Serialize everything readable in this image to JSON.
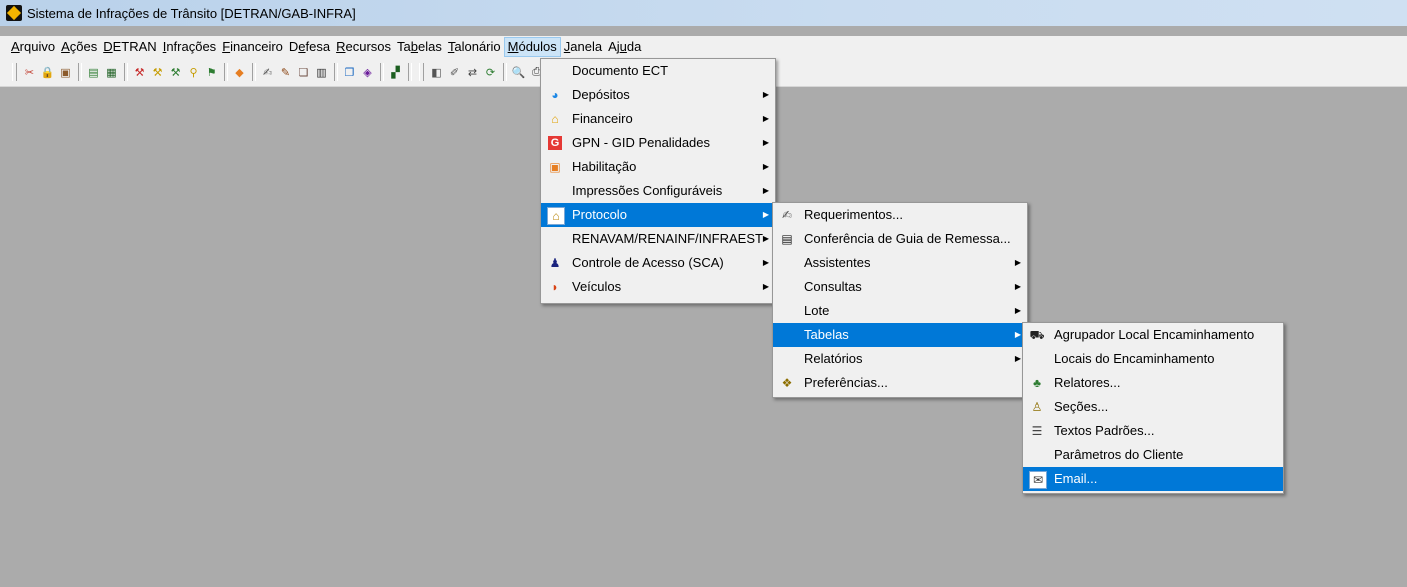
{
  "window": {
    "title": "Sistema de Infrações de Trânsito [DETRAN/GAB-INFRA]"
  },
  "menubar": [
    {
      "label": "Arquivo"
    },
    {
      "label": "Ações"
    },
    {
      "label": "DETRAN"
    },
    {
      "label": "Infrações"
    },
    {
      "label": "Financeiro"
    },
    {
      "label": "Defesa"
    },
    {
      "label": "Recursos"
    },
    {
      "label": "Tabelas"
    },
    {
      "label": "Talonário"
    },
    {
      "label": "Módulos"
    },
    {
      "label": "Janela"
    },
    {
      "label": "Ajuda"
    }
  ],
  "modulos_menu": [
    {
      "label": "Documento ECT",
      "icon": "",
      "submenu": false
    },
    {
      "label": "Depósitos",
      "icon": "deposit-icon",
      "submenu": true
    },
    {
      "label": "Financeiro",
      "icon": "finance-icon",
      "submenu": true
    },
    {
      "label": "GPN - GID Penalidades",
      "icon": "gpn-icon",
      "submenu": true
    },
    {
      "label": "Habilitação",
      "icon": "license-icon",
      "submenu": true
    },
    {
      "label": "Impressões Configuráveis",
      "icon": "",
      "submenu": true
    },
    {
      "label": "Protocolo",
      "icon": "protocol-icon",
      "submenu": true,
      "selected": true
    },
    {
      "label": "RENAVAM/RENAINF/INFRAEST",
      "icon": "",
      "submenu": true
    },
    {
      "label": "Controle de Acesso (SCA)",
      "icon": "access-icon",
      "submenu": true
    },
    {
      "label": "Veículos",
      "icon": "vehicle-icon",
      "submenu": true
    }
  ],
  "protocolo_menu": [
    {
      "label": "Requerimentos...",
      "icon": "request-icon",
      "submenu": false
    },
    {
      "label": "Conferência de Guia de Remessa...",
      "icon": "guide-icon",
      "submenu": false
    },
    {
      "label": "Assistentes",
      "icon": "",
      "submenu": true
    },
    {
      "label": "Consultas",
      "icon": "",
      "submenu": true
    },
    {
      "label": "Lote",
      "icon": "",
      "submenu": true
    },
    {
      "label": "Tabelas",
      "icon": "",
      "submenu": true,
      "selected": true
    },
    {
      "label": "Relatórios",
      "icon": "",
      "submenu": true
    },
    {
      "label": "Preferências...",
      "icon": "preferences-icon",
      "submenu": false
    }
  ],
  "tabelas_menu": [
    {
      "label": "Agrupador Local Encaminhamento",
      "icon": "group-icon"
    },
    {
      "label": "Locais do Encaminhamento",
      "icon": ""
    },
    {
      "label": "Relatores...",
      "icon": "rapporteur-icon"
    },
    {
      "label": "Seções...",
      "icon": "sections-icon"
    },
    {
      "label": "Textos Padrões...",
      "icon": "texts-icon"
    },
    {
      "label": "Parâmetros do Cliente",
      "icon": ""
    },
    {
      "label": "Email...",
      "icon": "email-icon",
      "selected": true
    }
  ],
  "colors": {
    "selection": "#0078d7",
    "desktop": "#ababab",
    "menu_bg": "#f0f0f0"
  }
}
